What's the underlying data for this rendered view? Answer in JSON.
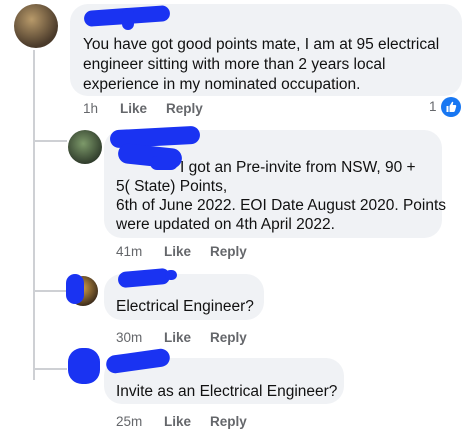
{
  "comments": [
    {
      "lines": [
        "You have got good points mate, I am at 95 electrical",
        "engineer sitting with  more than 2 years local",
        "experience in my nominated occupation."
      ],
      "time": "1h",
      "like": "Like",
      "reply": "Reply",
      "reaction_count": "1",
      "reaction_icon": "thumbs-up-icon"
    },
    {
      "lines": [
        "I got an Pre-invite from NSW, 90 +",
        "5( State) Points,",
        "6th of June 2022.  EOI Date August 2020. Points",
        "were updated on 4th April 2022."
      ],
      "time": "41m",
      "like": "Like",
      "reply": "Reply"
    },
    {
      "lines": [
        "Electrical Engineer?"
      ],
      "time": "30m",
      "like": "Like",
      "reply": "Reply"
    },
    {
      "lines": [
        "Invite  as an Electrical Engineer?"
      ],
      "time": "25m",
      "like": "Like",
      "reply": "Reply"
    }
  ],
  "colors": {
    "redaction": "#1a33f2",
    "reaction": "#1877f2",
    "bubble": "#f0f2f5",
    "meta": "#65676b"
  }
}
